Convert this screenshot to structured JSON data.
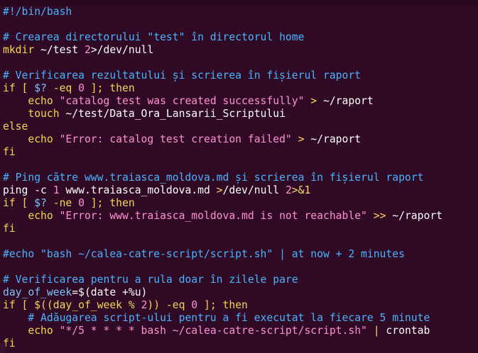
{
  "editor": {
    "lines": [
      [
        {
          "t": "#!/bin/bash",
          "c": "comment"
        }
      ],
      [],
      [
        {
          "t": "# Crearea directorului \"test\" în directorul home",
          "c": "comment"
        }
      ],
      [
        {
          "t": "mkdir",
          "c": "builtin"
        },
        {
          "t": " ~/test ",
          "c": "text"
        },
        {
          "t": "2",
          "c": "num"
        },
        {
          "t": ">/dev/null",
          "c": "text"
        }
      ],
      [],
      [
        {
          "t": "# Verificarea rezultatului și scrierea în fișierul raport",
          "c": "comment"
        }
      ],
      [
        {
          "t": "if",
          "c": "keyword"
        },
        {
          "t": " [ ",
          "c": "keyword"
        },
        {
          "t": "$?",
          "c": "var"
        },
        {
          "t": " -eq ",
          "c": "keyword"
        },
        {
          "t": "0",
          "c": "num"
        },
        {
          "t": " ]; ",
          "c": "keyword"
        },
        {
          "t": "then",
          "c": "keyword"
        }
      ],
      [
        {
          "t": "    ",
          "c": "text"
        },
        {
          "t": "echo",
          "c": "builtin"
        },
        {
          "t": " \"catalog test was created successfully\"",
          "c": "string"
        },
        {
          "t": " > ",
          "c": "op"
        },
        {
          "t": "~/raport",
          "c": "text"
        }
      ],
      [
        {
          "t": "    ",
          "c": "text"
        },
        {
          "t": "touch",
          "c": "builtin"
        },
        {
          "t": " ~/test/Data_Ora_Lansarii_Scriptului",
          "c": "text"
        }
      ],
      [
        {
          "t": "else",
          "c": "keyword"
        }
      ],
      [
        {
          "t": "    ",
          "c": "text"
        },
        {
          "t": "echo",
          "c": "builtin"
        },
        {
          "t": " \"Error: catalog test creation failed\"",
          "c": "string"
        },
        {
          "t": " > ",
          "c": "op"
        },
        {
          "t": "~/raport",
          "c": "text"
        }
      ],
      [
        {
          "t": "fi",
          "c": "keyword"
        }
      ],
      [],
      [
        {
          "t": "# Ping către www.traiasca_moldova.md și scrierea în fișierul raport",
          "c": "comment"
        }
      ],
      [
        {
          "t": "ping -c ",
          "c": "text"
        },
        {
          "t": "1",
          "c": "num"
        },
        {
          "t": " www.traiasca_moldova.md ",
          "c": "text"
        },
        {
          "t": ">",
          "c": "op"
        },
        {
          "t": "/dev/null ",
          "c": "text"
        },
        {
          "t": "2",
          "c": "num"
        },
        {
          "t": ">&1",
          "c": "op"
        }
      ],
      [
        {
          "t": "if",
          "c": "keyword"
        },
        {
          "t": " [ ",
          "c": "keyword"
        },
        {
          "t": "$?",
          "c": "var"
        },
        {
          "t": " -ne ",
          "c": "keyword"
        },
        {
          "t": "0",
          "c": "num"
        },
        {
          "t": " ]; ",
          "c": "keyword"
        },
        {
          "t": "then",
          "c": "keyword"
        }
      ],
      [
        {
          "t": "    ",
          "c": "text"
        },
        {
          "t": "echo",
          "c": "builtin"
        },
        {
          "t": " \"Error: www.traiasca_moldova.md is not reachable\"",
          "c": "string"
        },
        {
          "t": " >> ",
          "c": "op"
        },
        {
          "t": "~/raport",
          "c": "text"
        }
      ],
      [
        {
          "t": "fi",
          "c": "keyword"
        }
      ],
      [],
      [
        {
          "t": "#echo \"bash ~/calea-catre-script/script.sh\" | at now + 2 minutes",
          "c": "comment"
        }
      ],
      [],
      [
        {
          "t": "# Verificarea pentru a rula doar în zilele pare",
          "c": "comment"
        }
      ],
      [
        {
          "t": "day_of_week",
          "c": "var"
        },
        {
          "t": "=$(date +%u)",
          "c": "text"
        }
      ],
      [
        {
          "t": "if",
          "c": "keyword"
        },
        {
          "t": " [ ",
          "c": "keyword"
        },
        {
          "t": "$((day_of_week % ",
          "c": "keyword"
        },
        {
          "t": "2",
          "c": "num"
        },
        {
          "t": "))",
          "c": "keyword"
        },
        {
          "t": " -eq ",
          "c": "keyword"
        },
        {
          "t": "0",
          "c": "num"
        },
        {
          "t": " ]; ",
          "c": "keyword"
        },
        {
          "t": "then",
          "c": "keyword"
        }
      ],
      [
        {
          "t": "    ",
          "c": "text"
        },
        {
          "t": "# Adăugarea script-ului pentru a fi executat la fiecare 5 minute",
          "c": "comment"
        }
      ],
      [
        {
          "t": "    ",
          "c": "text"
        },
        {
          "t": "echo",
          "c": "builtin"
        },
        {
          "t": " \"*/5 * * * * bash ~/calea-catre-script/script.sh\"",
          "c": "string"
        },
        {
          "t": " | ",
          "c": "op"
        },
        {
          "t": "crontab",
          "c": "text"
        }
      ],
      [
        {
          "t": "fi",
          "c": "keyword"
        }
      ]
    ]
  }
}
